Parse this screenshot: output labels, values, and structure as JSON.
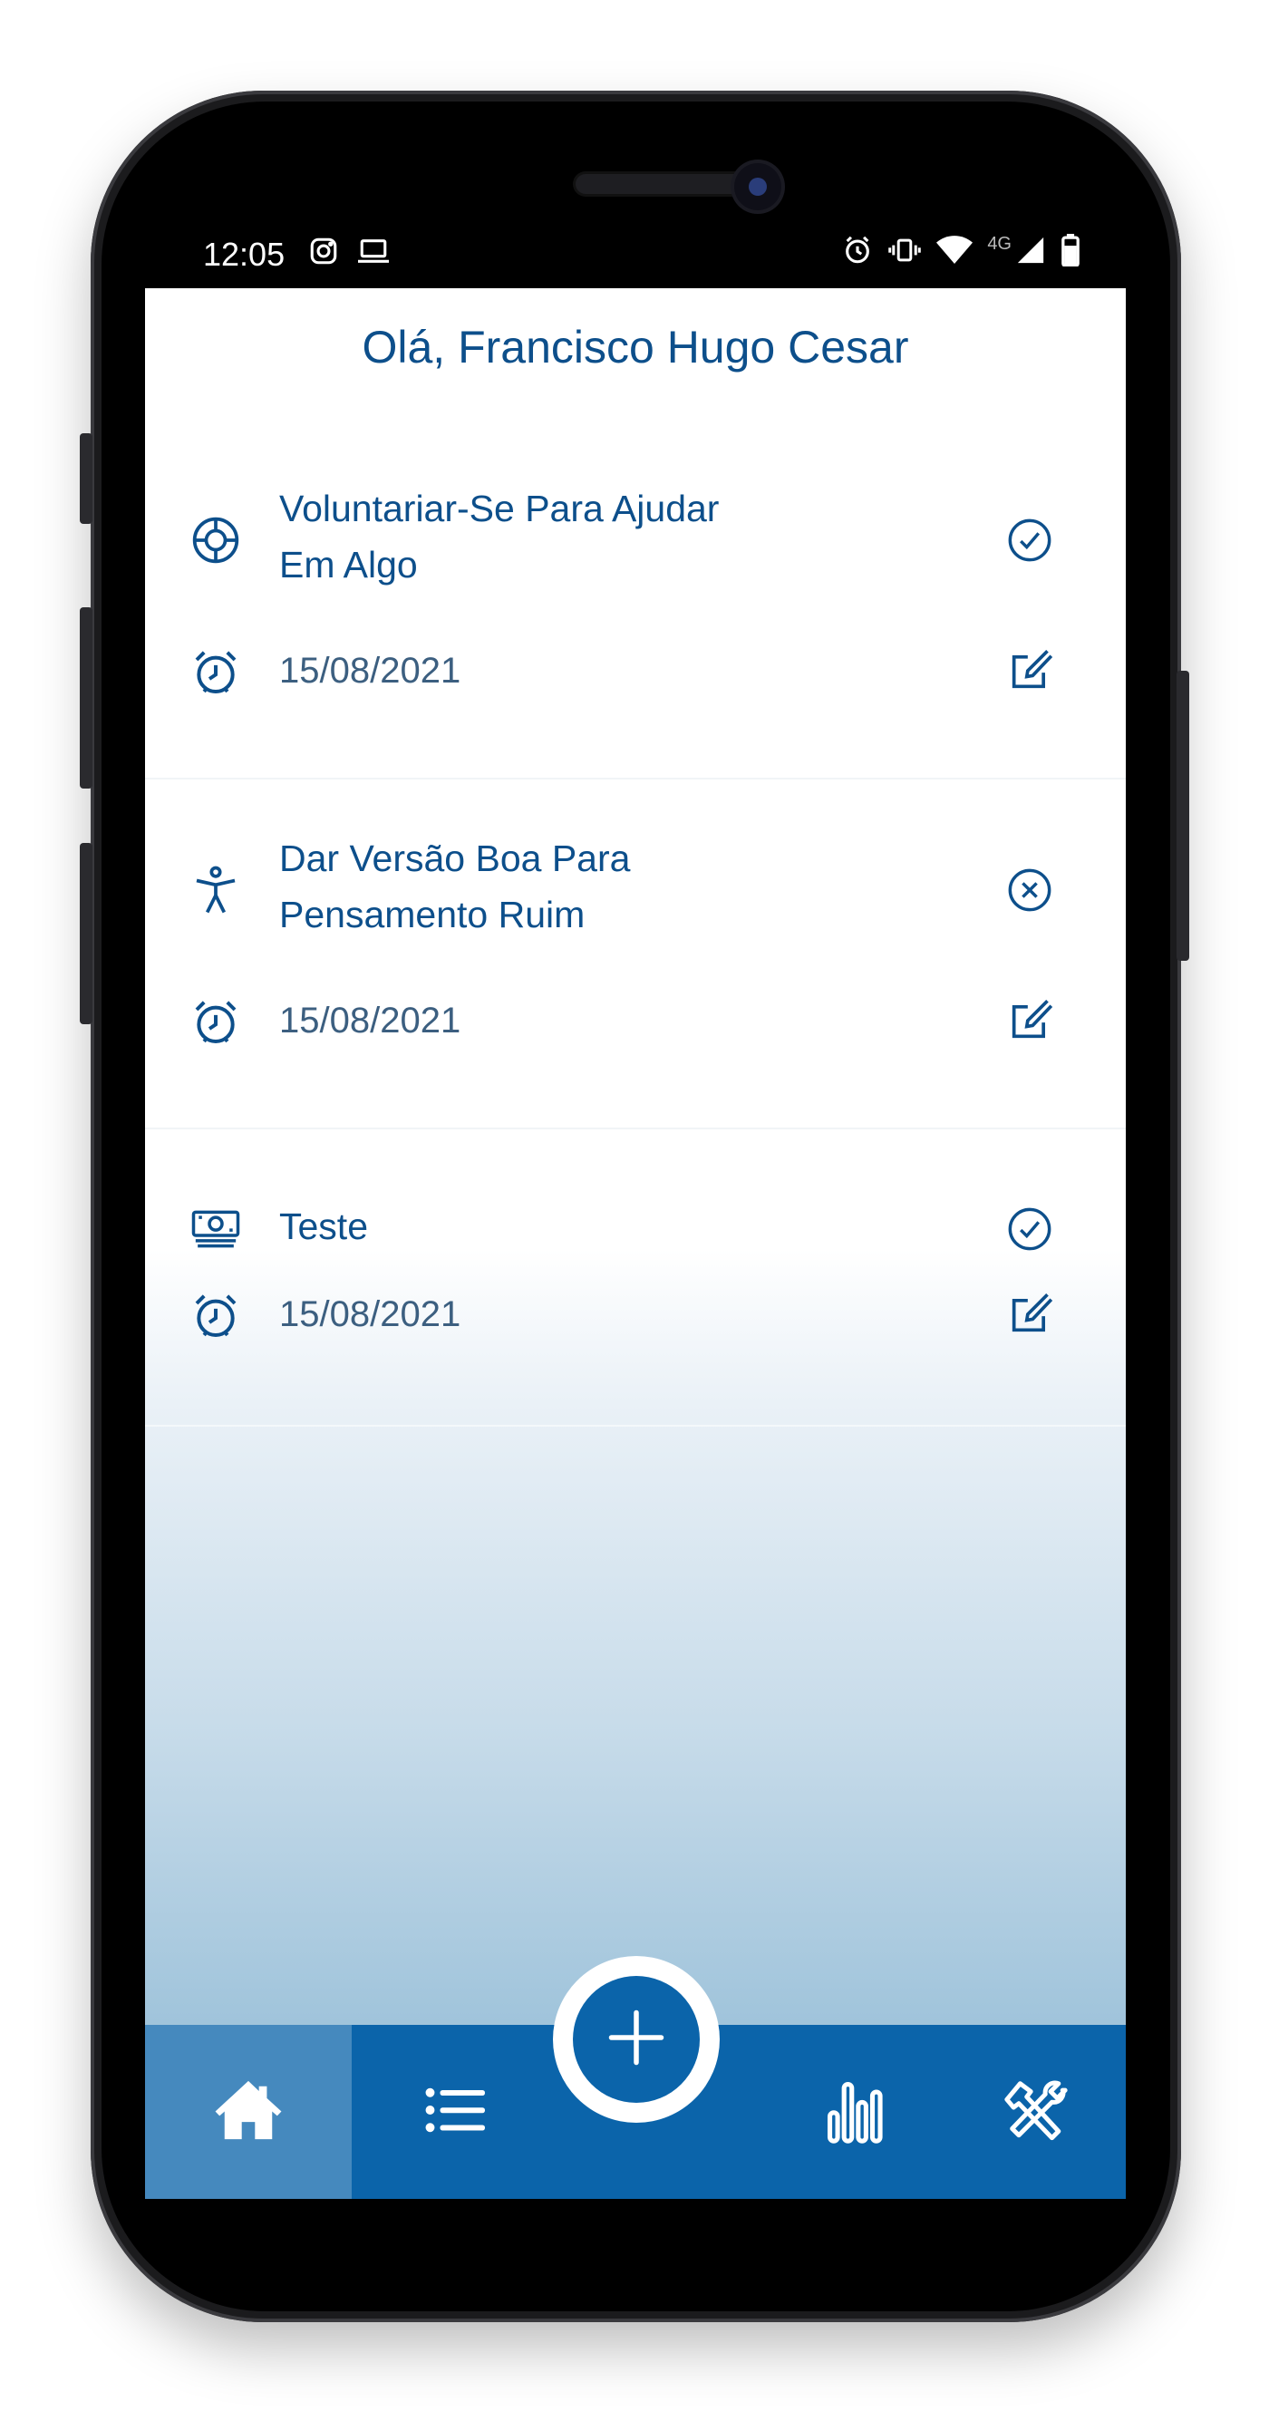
{
  "status_bar": {
    "time": "12:05",
    "left_icons": [
      "instagram-icon",
      "laptop-icon"
    ],
    "right_icons": [
      "alarm-icon",
      "vibrate-icon",
      "wifi-icon",
      "4g-signal-icon",
      "battery-icon"
    ],
    "network_label": "4G"
  },
  "header": {
    "greeting": "Olá, Francisco Hugo Cesar"
  },
  "tasks": [
    {
      "icon": "life-ring-icon",
      "title_line1": "Voluntariar-Se Para Ajudar",
      "title_line2": "Em Algo",
      "date": "15/08/2021",
      "status_icon": "check-circle-icon",
      "edit_icon": "edit-icon"
    },
    {
      "icon": "accessibility-person-icon",
      "title_line1": "Dar Versão Boa Para",
      "title_line2": "Pensamento Ruim",
      "date": "15/08/2021",
      "status_icon": "x-circle-icon",
      "edit_icon": "edit-icon"
    },
    {
      "icon": "money-icon",
      "title_line1": "Teste",
      "date": "15/08/2021",
      "status_icon": "check-circle-icon",
      "edit_icon": "edit-icon"
    }
  ],
  "bottom_nav": {
    "items": [
      "home-icon",
      "list-icon",
      "add-icon",
      "bar-chart-icon",
      "tools-icon"
    ],
    "active": "home"
  },
  "colors": {
    "primary": "#0b64aa",
    "primary_active": "#4589be",
    "text_primary": "#0d4f8b",
    "gradient_bottom": "#8cb7d4"
  }
}
